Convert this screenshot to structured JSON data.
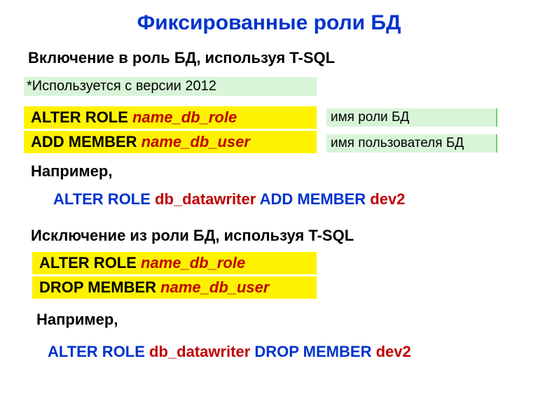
{
  "title": "Фиксированные роли БД",
  "section1": {
    "heading": "Включение в роль БД, используя T-SQL",
    "note": "*Используется с версии 2012",
    "code": {
      "line1_kw": "ALTER ROLE ",
      "line1_param": "name_db_role",
      "line2_kw": "ADD MEMBER ",
      "line2_param": "name_db_user"
    },
    "hint1": "имя роли БД",
    "hint2": "имя пользователя БД",
    "example_label": "Например,",
    "example": {
      "p1": "ALTER ROLE  ",
      "p2": "db_datawriter",
      "p3": " ADD MEMBER ",
      "p4": "dev2"
    }
  },
  "section2": {
    "heading": "Исключение из роли БД, используя T-SQL",
    "code": {
      "line1_kw": "ALTER ROLE ",
      "line1_param": "name_db_role",
      "line2_kw": "DROP MEMBER ",
      "line2_param": "name_db_user"
    },
    "example_label": "Например,",
    "example": {
      "p1": "ALTER ROLE  ",
      "p2": "db_datawriter",
      "p3": " DROP MEMBER ",
      "p4": "dev2"
    }
  }
}
